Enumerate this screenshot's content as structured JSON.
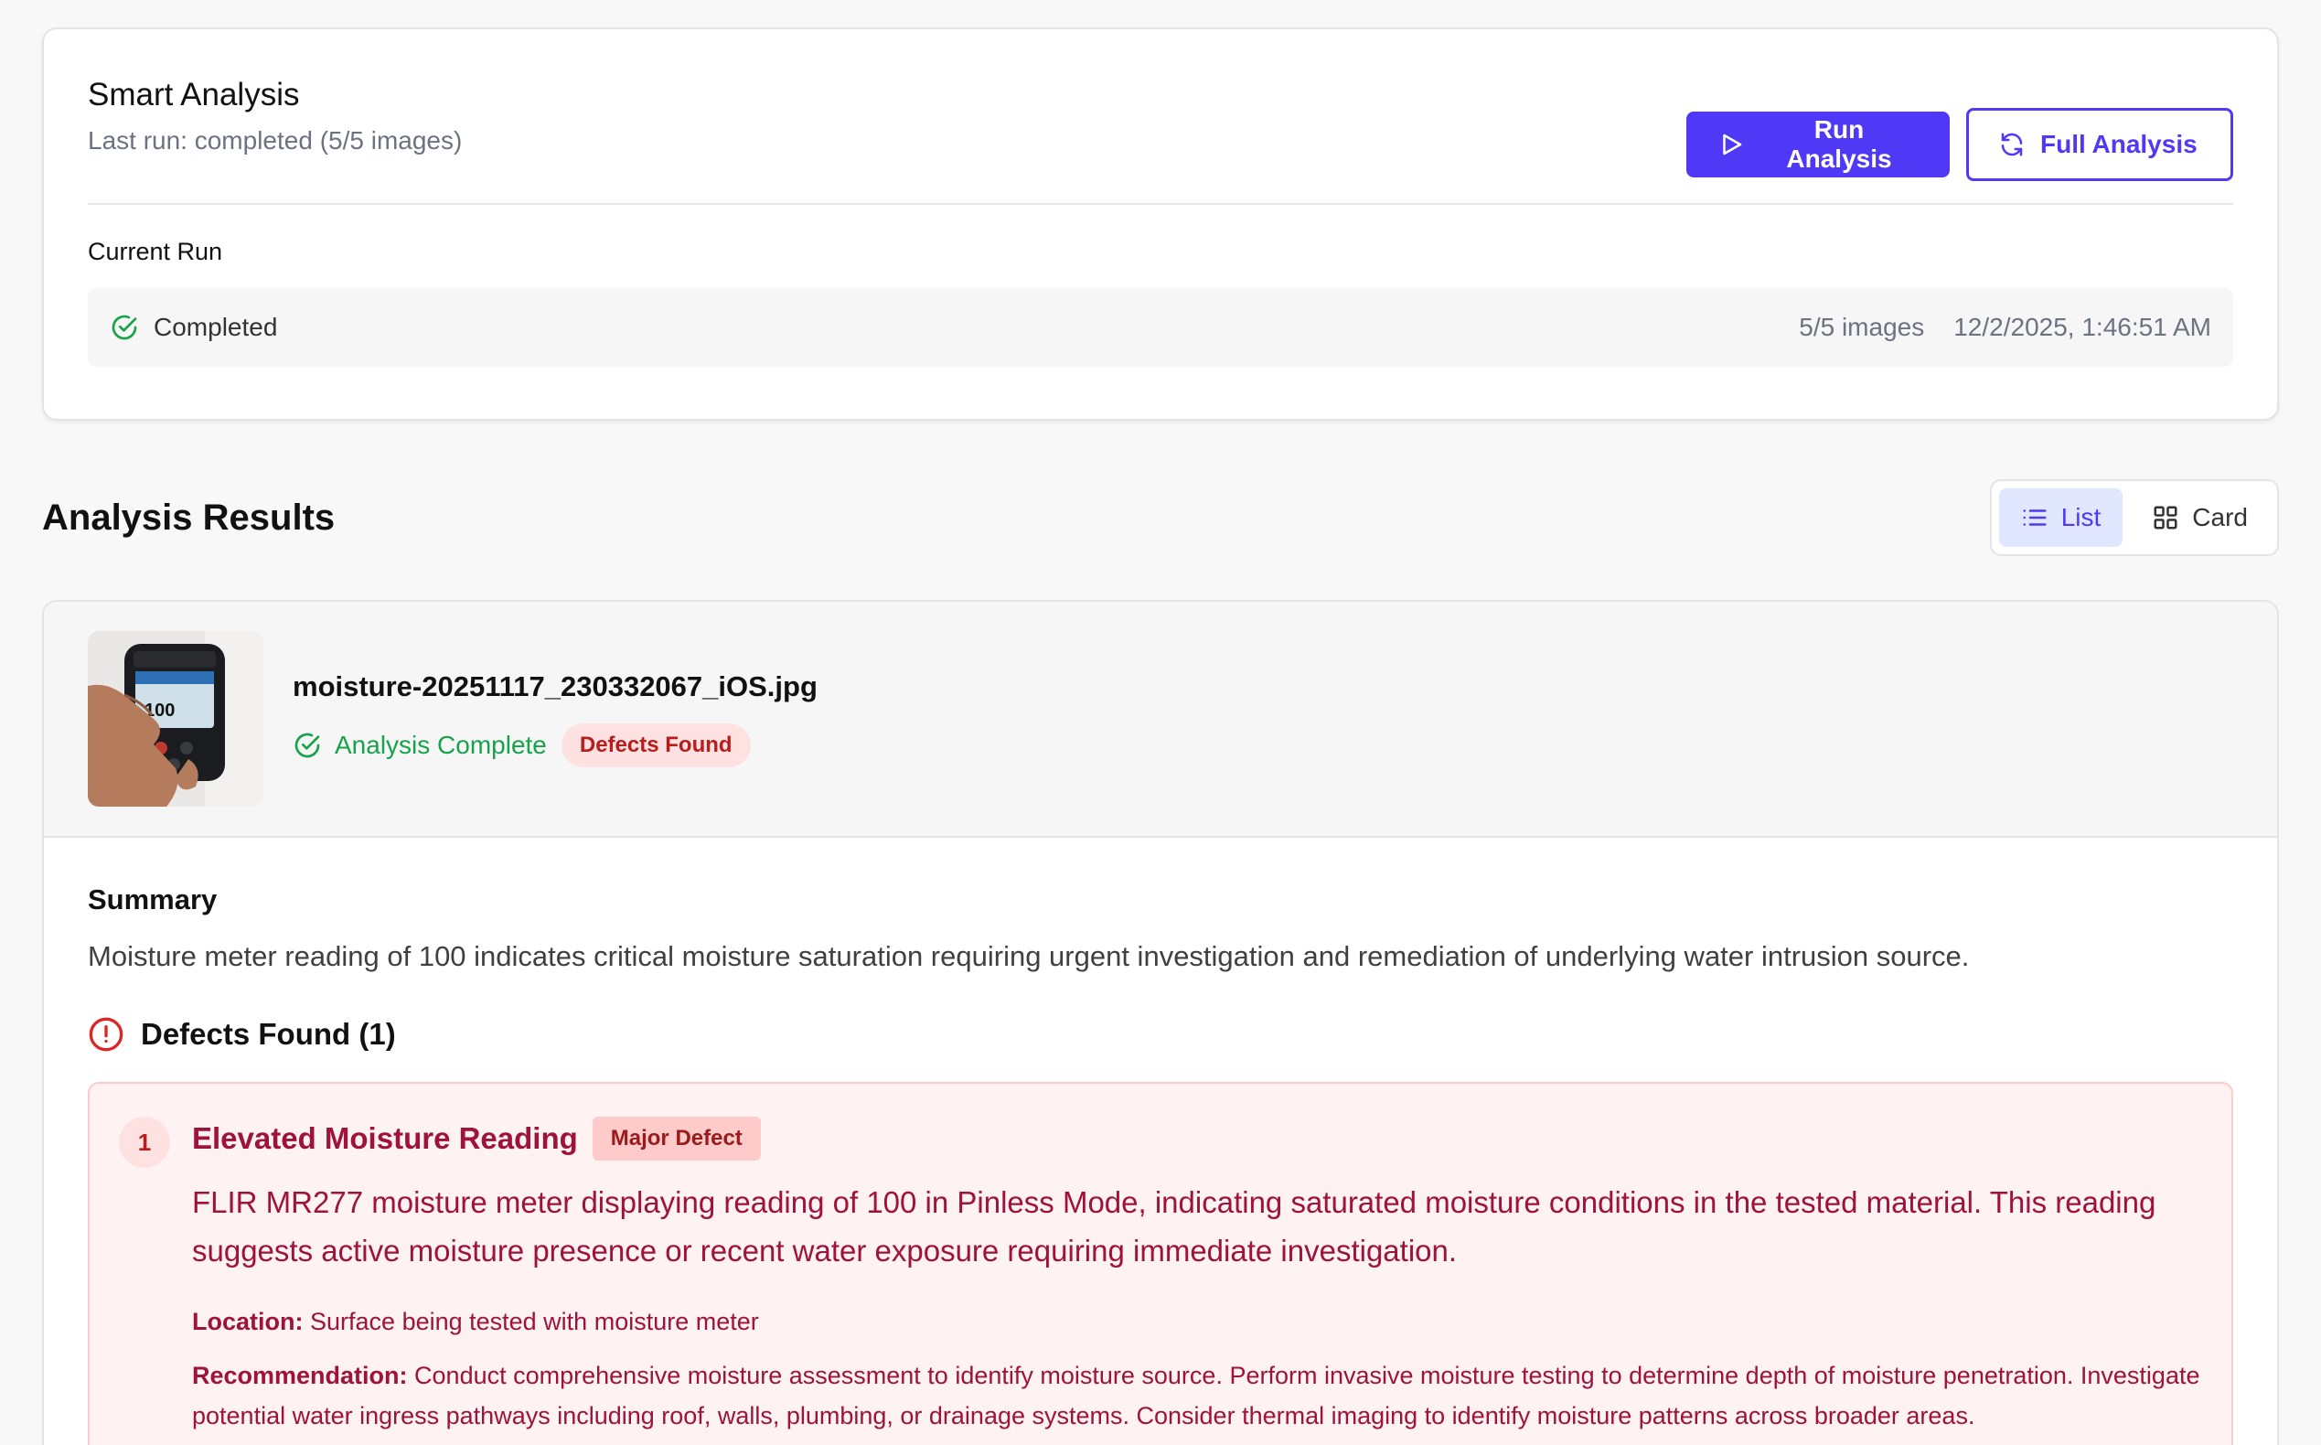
{
  "smart_analysis": {
    "title": "Smart Analysis",
    "last_run": "Last run: completed (5/5 images)",
    "run_button": "Run Analysis",
    "full_button": "Full Analysis",
    "current_run_label": "Current Run",
    "status": "Completed",
    "images": "5/5 images",
    "timestamp": "12/2/2025, 1:46:51 AM",
    "accent_color": "#4f39f6",
    "success_color": "#16a34a"
  },
  "results": {
    "title": "Analysis Results",
    "view_list": "List",
    "view_card": "Card",
    "selected_view": "List"
  },
  "item": {
    "file_name": "moisture-20251117_230332067_iOS.jpg",
    "status": "Analysis Complete",
    "badge": "Defects Found",
    "thumbnail_text": "100",
    "summary_title": "Summary",
    "summary_text": "Moisture meter reading of 100 indicates critical moisture saturation requiring urgent investigation and remediation of underlying water intrusion source.",
    "defects_title": "Defects Found (1)",
    "defects": [
      {
        "number": "1",
        "title": "Elevated Moisture Reading",
        "severity": "Major Defect",
        "description": "FLIR MR277 moisture meter displaying reading of 100 in Pinless Mode, indicating saturated moisture conditions in the tested material. This reading suggests active moisture presence or recent water exposure requiring immediate investigation.",
        "location_label": "Location:",
        "location": "Surface being tested with moisture meter",
        "recommendation_label": "Recommendation:",
        "recommendation": "Conduct comprehensive moisture assessment to identify moisture source. Perform invasive moisture testing to determine depth of moisture penetration. Investigate potential water ingress pathways including roof, walls, plumbing, or drainage systems. Consider thermal imaging to identify moisture patterns across broader areas."
      }
    ]
  }
}
